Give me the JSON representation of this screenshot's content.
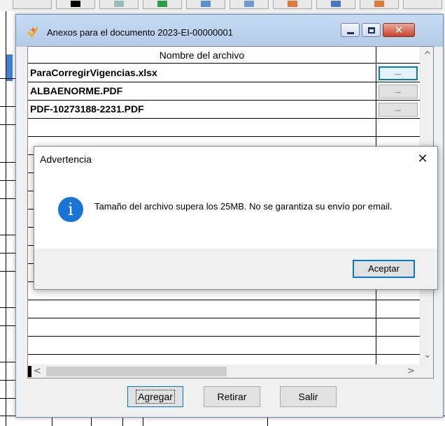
{
  "window": {
    "title": "Anexos para el documento 2023-EI-00000001",
    "caption_close": "✕"
  },
  "grid": {
    "column_header": "Nombre del archivo",
    "rows": [
      {
        "name": "ParaCorregirVigencias.xlsx",
        "button": "..."
      },
      {
        "name": "ALBAENORME.PDF",
        "button": "..."
      },
      {
        "name": "PDF-10273188-2231.PDF",
        "button": "..."
      }
    ],
    "scroll_up": "^",
    "scroll_down": "⌄",
    "scroll_left": "<",
    "scroll_right": ">"
  },
  "buttons": {
    "add": "Agregar",
    "remove": "Retirar",
    "exit": "Salir"
  },
  "dialog": {
    "title": "Advertencia",
    "close": "✕",
    "icon": "i",
    "message": "Tamaño del archivo supera los 25MB. No se garantiza su envío por email.",
    "ok": "Aceptar"
  },
  "colors": {
    "accent": "#0078d7",
    "info_icon": "#1a73d6"
  }
}
